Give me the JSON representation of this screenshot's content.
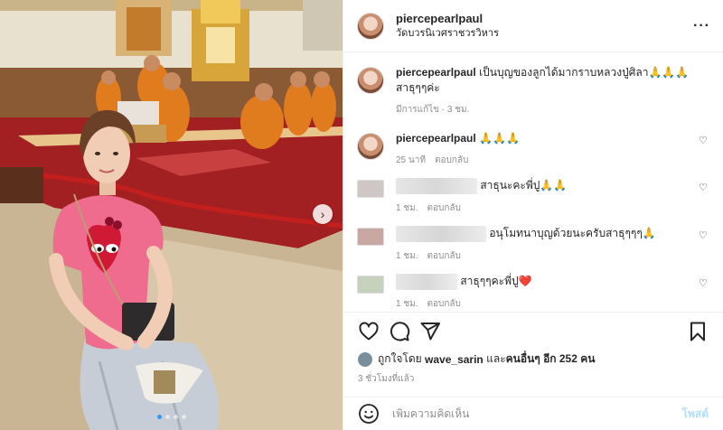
{
  "post": {
    "author": "piercepearlpaul",
    "location": "วัดบวรนิเวศราชวรวิหาร",
    "more_icon": "more-horizontal-icon"
  },
  "caption": {
    "author": "piercepearlpaul",
    "text": "เป็นบุญของลูกได้มากราบหลวงปู่ศิลา🙏🙏🙏 สาธุๆๆค่ะ",
    "edited": "มีการแก้ไข",
    "time": "3 ชม."
  },
  "comments": [
    {
      "author": "piercepearlpaul",
      "text": "🙏🙏🙏",
      "time": "25 นาที",
      "reply": "ตอบกลับ",
      "author_blurred": false
    },
    {
      "author": "",
      "text": "สาธุนะคะพี่ปู🙏🙏",
      "time": "1 ชม.",
      "reply": "ตอบกลับ",
      "author_blurred": true
    },
    {
      "author": "",
      "text": "อนุโมทนาบุญด้วยนะครับสาธุๆๆๆ🙏",
      "time": "1 ชม.",
      "reply": "ตอบกลับ",
      "author_blurred": true
    },
    {
      "author": "",
      "text": "สาธุๆๆคะพี่ปู❤️",
      "time": "1 ชม.",
      "reply": "ตอบกลับ",
      "author_blurred": true
    }
  ],
  "likes": {
    "prefix": "ถูกใจโดย",
    "user": "wave_sarin",
    "middle": "และ",
    "others": "คนอื่นๆ อีก 252 คน"
  },
  "posted_time": "3 ชั่วโมงที่แล้ว",
  "add_comment": {
    "placeholder": "เพิ่มความคิดเห็น",
    "post_label": "โพสต์"
  },
  "carousel": {
    "slides": 4,
    "active_index": 0
  },
  "colors": {
    "accent": "#3897f0",
    "post_disabled": "#b2dffc",
    "text": "#262626",
    "muted": "#8e8e8e"
  }
}
